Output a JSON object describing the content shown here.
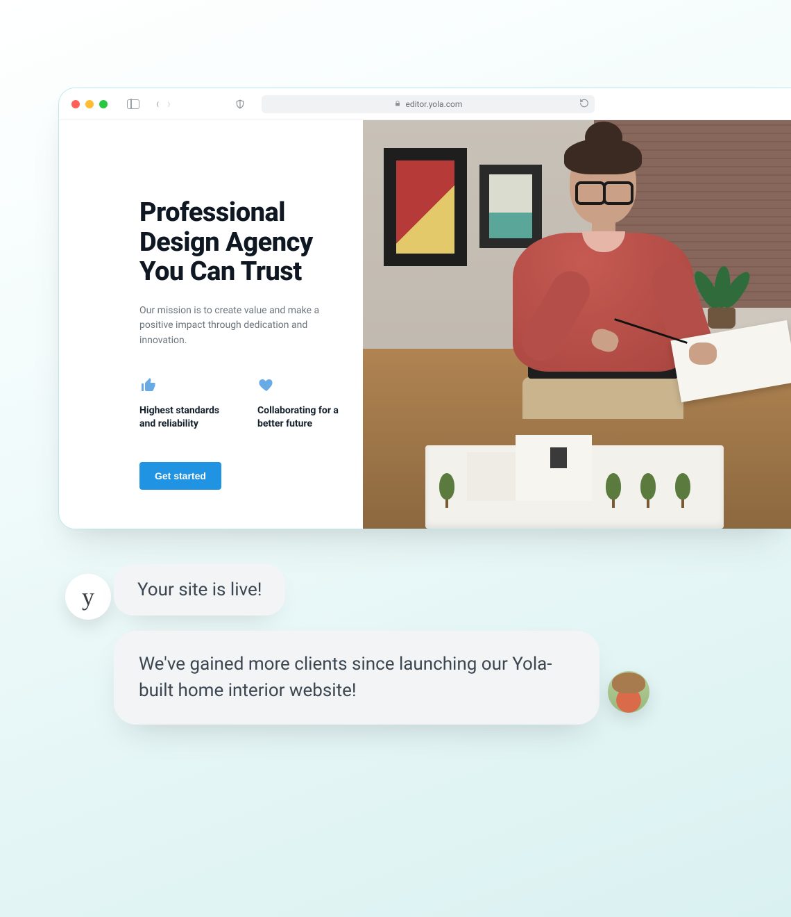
{
  "browser": {
    "url_host": "editor.yola.com",
    "traffic_lights": [
      "close",
      "minimize",
      "zoom"
    ]
  },
  "hero_page": {
    "heading_line1": "Professional",
    "heading_line2": "Design Agency",
    "heading_line3": "You Can Trust",
    "mission": "Our mission is to create value and make a positive impact through dedication and innovation.",
    "features": [
      {
        "icon": "thumbs-up-icon",
        "label": "Highest standards and reliability"
      },
      {
        "icon": "heart-icon",
        "label": "Collaborating for a better future"
      }
    ],
    "cta_label": "Get started",
    "image_alt": "Designer in a red shirt and glasses reviewing a drawing next to an architectural scale model"
  },
  "chat": {
    "brand_glyph": "y",
    "bubble1": "Your site is live!",
    "bubble2": "We've gained more clients since launching our Yola-built home interior website!"
  },
  "colors": {
    "accent_blue": "#2094e3",
    "icon_blue": "#68aae6",
    "bubble_bg": "#f2f4f6"
  }
}
